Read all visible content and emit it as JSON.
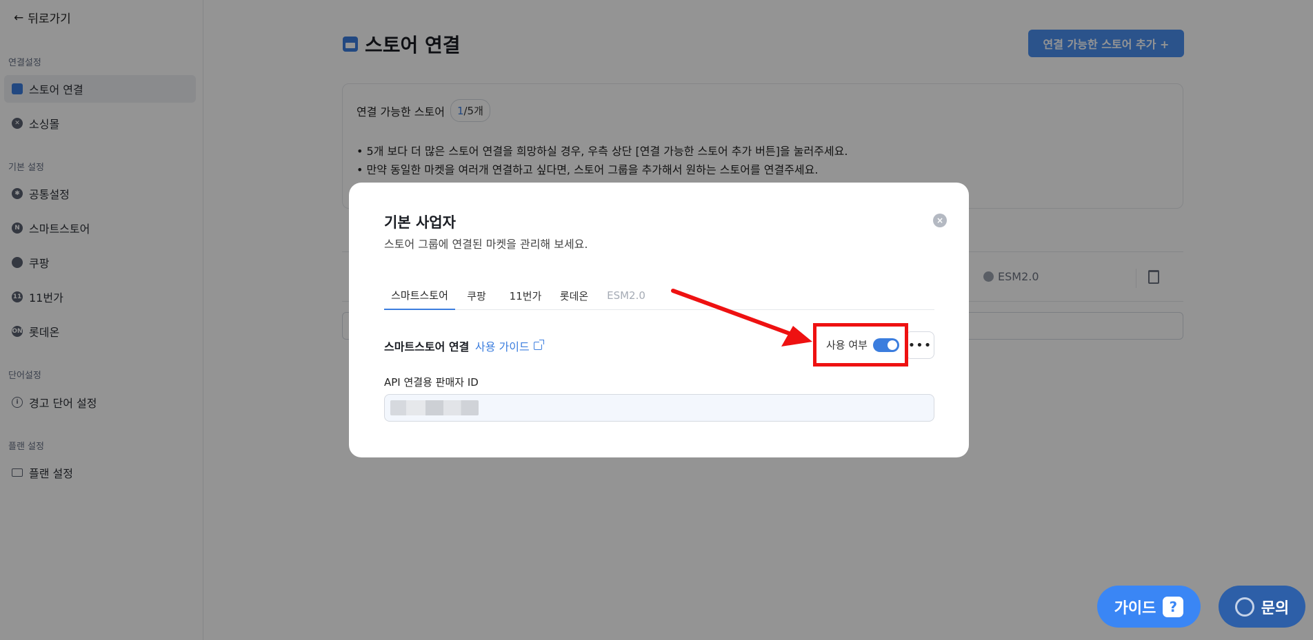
{
  "sidebar": {
    "back_label": "뒤로가기",
    "sections": [
      {
        "title": "연결설정",
        "items": [
          {
            "label": "스토어 연결",
            "icon": "store-icon",
            "active": true
          },
          {
            "label": "소싱몰",
            "icon": "sourcing-icon"
          }
        ]
      },
      {
        "title": "기본 설정",
        "items": [
          {
            "label": "공통설정",
            "icon": "gear-icon"
          },
          {
            "label": "스마트스토어",
            "icon": "naver-icon"
          },
          {
            "label": "쿠팡",
            "icon": "coupang-icon"
          },
          {
            "label": "11번가",
            "icon": "eleventh-icon"
          },
          {
            "label": "롯데온",
            "icon": "lotteon-icon"
          }
        ]
      },
      {
        "title": "단어설정",
        "items": [
          {
            "label": "경고 단어 설정",
            "icon": "info-icon"
          }
        ]
      },
      {
        "title": "플랜 설정",
        "items": [
          {
            "label": "플랜 설정",
            "icon": "card-icon"
          }
        ]
      }
    ]
  },
  "header": {
    "title": "스토어 연결",
    "add_button": "연결 가능한 스토어 추가 +"
  },
  "info": {
    "label": "연결 가능한 스토어",
    "count_current": "1",
    "count_rest": "/5개",
    "lines": [
      "• 5개 보다 더 많은 스토어 연결을 희망하실 경우, 우측 상단 [연결 가능한 스토어 추가 버튼]을 눌러주세요.",
      "• 만약 동일한 마켓을 여러개 연결하고 싶다면, 스토어 그룹을 추가해서 원하는 스토어를 연결주세요."
    ]
  },
  "store_row": {
    "esm_label": "ESM2.0"
  },
  "modal": {
    "title": "기본 사업자",
    "subtitle": "스토어 그룹에 연결된 마켓을 관리해 보세요.",
    "close_glyph": "×",
    "tabs": [
      {
        "label": "스마트스토어",
        "active": true
      },
      {
        "label": "쿠팡"
      },
      {
        "label": "11번가"
      },
      {
        "label": "롯데온"
      },
      {
        "label": "ESM2.0",
        "disabled": true
      }
    ],
    "connection_label": "스마트스토어 연결",
    "guide_link": "사용 가이드",
    "use_label": "사용 여부",
    "toggle_on": true,
    "more_glyph": "•••",
    "api_label": "API 연결용 판매자 ID"
  },
  "fabs": {
    "guide": "가이드",
    "guide_icon": "?",
    "inquiry": "문의"
  },
  "colors": {
    "accent": "#3b7dde",
    "annotation": "#ee1111",
    "overlay": "rgba(0,0,0,0.42)"
  }
}
